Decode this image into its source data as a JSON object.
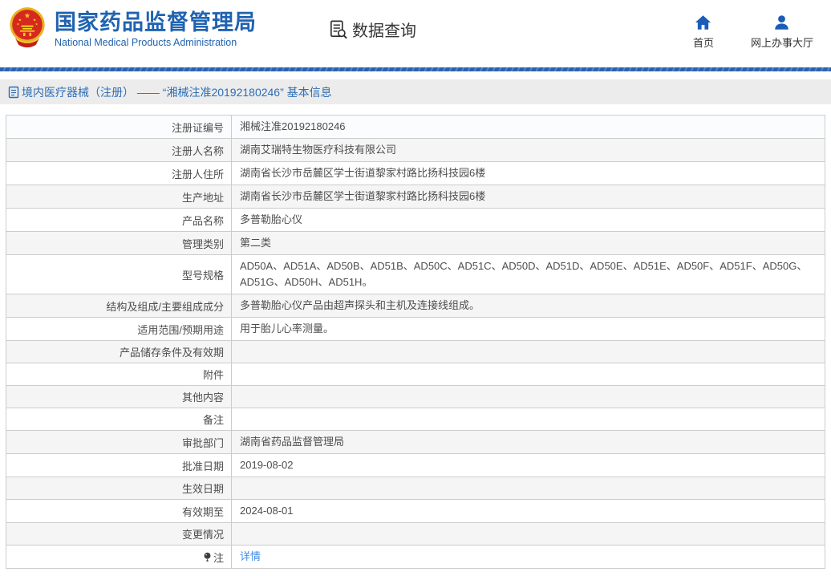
{
  "header": {
    "title": "国家药品监督管理局",
    "subtitle": "National Medical Products Administration",
    "data_query_label": "数据查询",
    "nav": [
      {
        "label": "首页",
        "icon": "home-icon"
      },
      {
        "label": "网上办事大厅",
        "icon": "user-icon"
      }
    ]
  },
  "breadcrumb": {
    "icon": "document-icon",
    "text": "境内医疗器械（注册） —— “湘械注准20192180246” 基本信息"
  },
  "table": {
    "rows": [
      {
        "label": "注册证编号",
        "value": "湘械注准20192180246"
      },
      {
        "label": "注册人名称",
        "value": "湖南艾瑞特生物医疗科技有限公司"
      },
      {
        "label": "注册人住所",
        "value": "湖南省长沙市岳麓区学士街道黎家村路比扬科技园6楼"
      },
      {
        "label": "生产地址",
        "value": "湖南省长沙市岳麓区学士街道黎家村路比扬科技园6楼"
      },
      {
        "label": "产品名称",
        "value": "多普勒胎心仪"
      },
      {
        "label": "管理类别",
        "value": "第二类"
      },
      {
        "label": "型号规格",
        "value": "AD50A、AD51A、AD50B、AD51B、AD50C、AD51C、AD50D、AD51D、AD50E、AD51E、AD50F、AD51F、AD50G、AD51G、AD50H、AD51H。",
        "tall": true
      },
      {
        "label": "结构及组成/主要组成成分",
        "value": "多普勒胎心仪产品由超声探头和主机及连接线组成。"
      },
      {
        "label": "适用范围/预期用途",
        "value": "用于胎儿心率测量。"
      },
      {
        "label": "产品储存条件及有效期",
        "value": ""
      },
      {
        "label": "附件",
        "value": ""
      },
      {
        "label": "其他内容",
        "value": ""
      },
      {
        "label": "备注",
        "value": ""
      },
      {
        "label": "审批部门",
        "value": "湖南省药品监督管理局"
      },
      {
        "label": "批准日期",
        "value": "2019-08-02"
      },
      {
        "label": "生效日期",
        "value": ""
      },
      {
        "label": "有效期至",
        "value": "2024-08-01"
      },
      {
        "label": "变更情况",
        "value": ""
      },
      {
        "label": "注",
        "label_icon": "note-balloon-icon",
        "value_link": "详情"
      }
    ]
  },
  "colors": {
    "brand_blue": "#2063b0",
    "icon_blue": "#1b5cb8",
    "breadcrumb_text": "#2e6db4",
    "link_blue": "#3f8cea",
    "row_alt_bg": "#f5f5f5",
    "border": "#cccccc",
    "breadcrumb_bg": "#ececec",
    "emblem_red": "#d5281e",
    "emblem_gold": "#e8b21a"
  }
}
